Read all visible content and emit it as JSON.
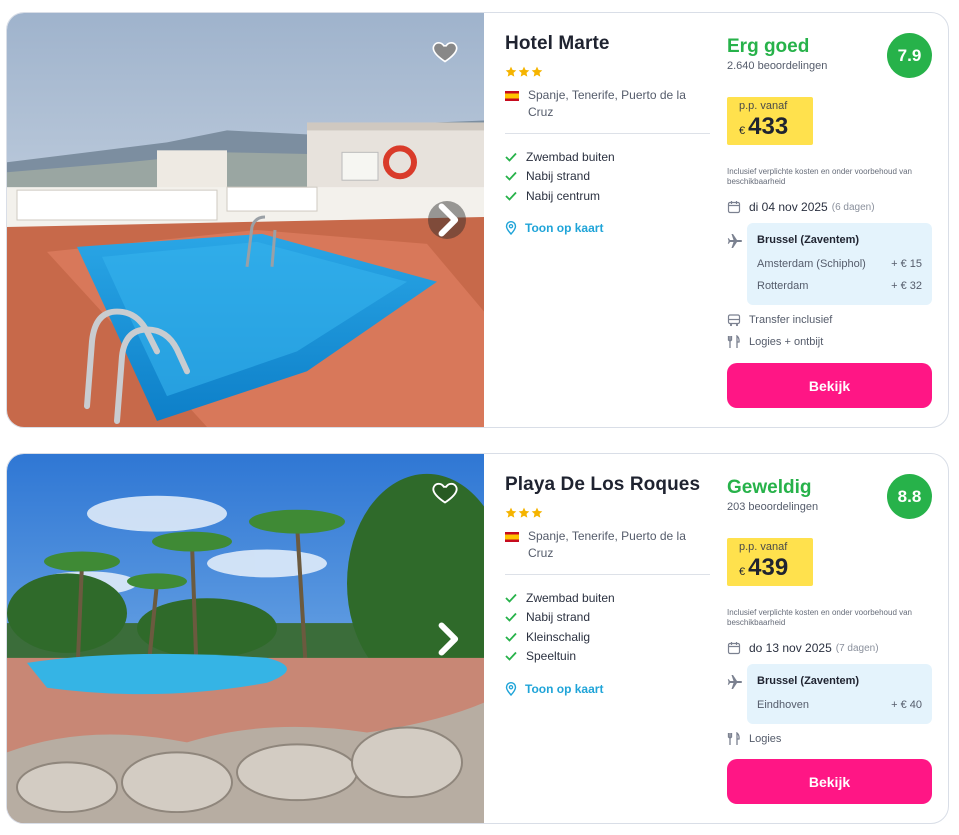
{
  "results": [
    {
      "hotel_name": "Hotel Marte",
      "stars": 3,
      "location": "Spanje, Tenerife, Puerto de la Cruz",
      "features": [
        "Zwembad buiten",
        "Nabij strand",
        "Nabij centrum"
      ],
      "map_link": "Toon op kaart",
      "rating_word": "Erg goed",
      "reviews": "2.640 beoordelingen",
      "score": "7.9",
      "price_label": "p.p. vanaf",
      "currency": "€",
      "price": "433",
      "disclaimer": "Inclusief verplichte kosten en onder voorbehoud van beschikbaarheid",
      "date": "di 04 nov 2025",
      "duration": "(6 dagen)",
      "main_airport": "Brussel (Zaventem)",
      "alt_airports": [
        {
          "name": "Amsterdam (Schiphol)",
          "surcharge": "+ € 15"
        },
        {
          "name": "Rotterdam",
          "surcharge": "+ € 32"
        }
      ],
      "amenities": [
        {
          "icon": "bus-icon",
          "label": "Transfer inclusief"
        },
        {
          "icon": "cutlery-icon",
          "label": "Logies + ontbijt"
        }
      ],
      "cta": "Bekijk"
    },
    {
      "hotel_name": "Playa De Los Roques",
      "stars": 3,
      "location": "Spanje, Tenerife, Puerto de la Cruz",
      "features": [
        "Zwembad buiten",
        "Nabij strand",
        "Kleinschalig",
        "Speeltuin"
      ],
      "map_link": "Toon op kaart",
      "rating_word": "Geweldig",
      "reviews": "203 beoordelingen",
      "score": "8.8",
      "price_label": "p.p. vanaf",
      "currency": "€",
      "price": "439",
      "disclaimer": "Inclusief verplichte kosten en onder voorbehoud van beschikbaarheid",
      "date": "do 13 nov 2025",
      "duration": "(7 dagen)",
      "main_airport": "Brussel (Zaventem)",
      "alt_airports": [
        {
          "name": "Eindhoven",
          "surcharge": "+ € 40"
        }
      ],
      "amenities": [
        {
          "icon": "cutlery-icon",
          "label": "Logies"
        }
      ],
      "cta": "Bekijk"
    }
  ],
  "colors": {
    "rating_green": "#27b24a",
    "price_yellow": "#ffe14d",
    "cta_pink": "#ff1685",
    "link_blue": "#1fa4d8",
    "airport_bg": "#e4f3fc"
  }
}
